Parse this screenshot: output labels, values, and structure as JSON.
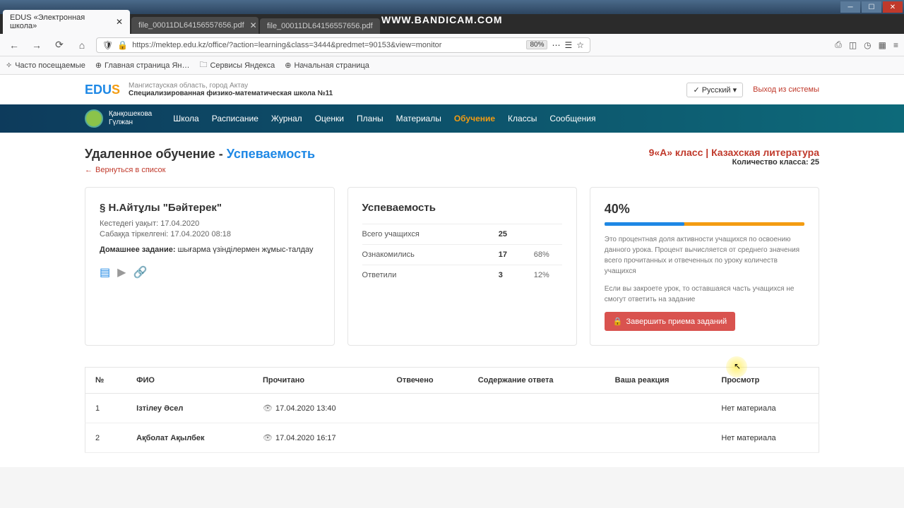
{
  "watermark": "WWW.BANDICAM.COM",
  "tabs": [
    {
      "title": "EDUS «Электронная школа»",
      "active": true
    },
    {
      "title": "file_00011DL64156557656.pdf",
      "active": false
    },
    {
      "title": "file_00011DL64156557656.pdf",
      "active": false
    }
  ],
  "url": "https://mektep.edu.kz/office/?action=learning&class=3444&predmet=90153&view=monitor",
  "zoom": "80%",
  "bookmarks": [
    "Часто посещаемые",
    "Главная страница Ян…",
    "Сервисы Яндекса",
    "Начальная страница"
  ],
  "site": {
    "region": "Мангистауская область, город Актау",
    "school": "Специализированная физико-математическая школа №11",
    "lang": "Русский",
    "logout": "Выход из системы"
  },
  "user": {
    "line1": "Қанқошекова",
    "line2": "Гүлжан"
  },
  "nav": [
    "Школа",
    "Расписание",
    "Журнал",
    "Оценки",
    "Планы",
    "Материалы",
    "Обучение",
    "Классы",
    "Сообщения"
  ],
  "nav_active": "Обучение",
  "page": {
    "title_prefix": "Удаленное обучение - ",
    "title_suffix": "Успеваемость",
    "back": "Вернуться в список",
    "class_label": "9«А» класс | Казахская литература",
    "count_label": "Количество класса: 25"
  },
  "lesson": {
    "title": "§ Н.Айтұлы \"Бәйтерек\"",
    "time_label": "Кестедегі уақыт: 17.04.2020",
    "reg_label": "Сабаққа тіркелгені: 17.04.2020 08:18",
    "hw_label": "Домашнее задание:",
    "hw_text": "шығарма үзінділермен жұмыс-талдау"
  },
  "stats": {
    "title": "Успеваемость",
    "rows": [
      {
        "label": "Всего учащихся",
        "val": "25",
        "pct": ""
      },
      {
        "label": "Ознакомились",
        "val": "17",
        "pct": "68%"
      },
      {
        "label": "Ответили",
        "val": "3",
        "pct": "12%"
      }
    ]
  },
  "progress": {
    "pct": "40%",
    "desc1": "Это процентная доля активности учащихся по освоению данного урока. Процент вычисляется от среднего значения всего прочитанных и отвеченных по уроку количеств учащихся",
    "desc2": "Если вы закроете урок, то оставшаяся часть учащихся не смогут ответить на задание",
    "btn": "Завершить приема заданий"
  },
  "table": {
    "headers": [
      "№",
      "ФИО",
      "Прочитано",
      "Отвечено",
      "Содержание ответа",
      "Ваша реакция",
      "Просмотр"
    ],
    "rows": [
      {
        "n": "1",
        "name": "Ізтілеу Әсел",
        "read": "17.04.2020 13:40",
        "view": "Нет материала"
      },
      {
        "n": "2",
        "name": "Ақболат Ақылбек",
        "read": "17.04.2020 16:17",
        "view": "Нет материала"
      }
    ]
  }
}
